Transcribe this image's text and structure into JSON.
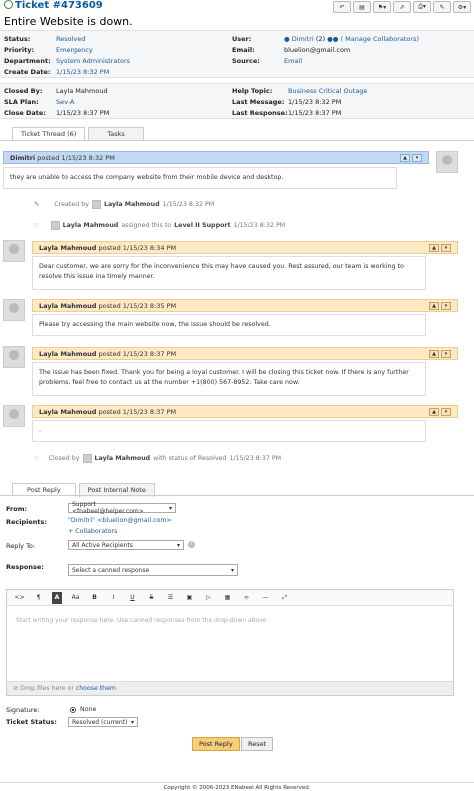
{
  "ticket": {
    "number": "Ticket #473609",
    "subject": "Entire Website is down."
  },
  "toolbar": {
    "icons": [
      "reply-icon",
      "file-icon",
      "flag-icon",
      "share-icon",
      "print-icon",
      "edit-icon",
      "gear-icon"
    ]
  },
  "info_left": [
    {
      "label": "Status:",
      "value": "Resolved"
    },
    {
      "label": "Priority:",
      "value": "Emergency"
    },
    {
      "label": "Department:",
      "value": "System Administrators"
    },
    {
      "label": "Create Date:",
      "value": "1/15/23 8:32 PM"
    }
  ],
  "info_right": {
    "user_label": "User:",
    "user_value": "Dimitri",
    "user_count": "(2)",
    "manage_link": "( Manage Collaborators)",
    "email_label": "Email:",
    "email_value": "bluelion@gmail.com",
    "source_label": "Source:",
    "source_value": "Email"
  },
  "info2_left": [
    {
      "label": "Closed By:",
      "value": "Layla Mahmoud"
    },
    {
      "label": "SLA Plan:",
      "value": "Sev-A"
    },
    {
      "label": "Close Date:",
      "value": "1/15/23 8:37 PM"
    }
  ],
  "info2_right": [
    {
      "label": "Help Topic:",
      "value": "Business Critical Outage"
    },
    {
      "label": "Last Message:",
      "value": "1/15/23 8:32 PM"
    },
    {
      "label": "Last Response:",
      "value": "1/15/23 8:37 PM"
    }
  ],
  "thread_tabs": {
    "thread": "Ticket Thread (6)",
    "tasks": "Tasks"
  },
  "messages": [
    {
      "author": "Dimitri",
      "posted": "posted",
      "time": "1/15/23 8:32 PM",
      "body": "they are unable to access the company website from their mobile device and desktop."
    },
    {
      "author": "Layla Mahmoud",
      "posted": "posted",
      "time": "1/15/23 8:34 PM",
      "body": "Dear customer, we are sorry for the inconvenience this may have caused you. Rest assured, our team is working to resolve this issue ina  timely manner."
    },
    {
      "author": "Layla Mahmoud",
      "posted": "posted",
      "time": "1/15/23 8:35 PM",
      "body": "Please try accessing the main website now, the issue should be resolved."
    },
    {
      "author": "Layla Mahmoud",
      "posted": "posted",
      "time": "1/15/23 8:37 PM",
      "body": "The issue has been fixed. Thank you for being a loyal customer. I will be closing this ticket now. If there is any further problems, feel free to contact us at the number +1(800) 567-8952. Take care now."
    },
    {
      "author": "Layla Mahmoud",
      "posted": "posted",
      "time": "1/15/23 8:37 PM",
      "body": "."
    }
  ],
  "events": {
    "created_by": "Created by",
    "created_who": "Layla Mahmoud",
    "created_time": "1/15/23 8:32 PM",
    "assigned_who": "Layla Mahmoud",
    "assigned_text": "assigned this to",
    "assigned_target": "Level II Support",
    "assigned_time": "1/15/23 8:32 PM",
    "closed_by": "Closed by",
    "closed_who": "Layla Mahmoud",
    "closed_text": "with status of Resolved",
    "closed_time": "1/15/23 8:37 PM"
  },
  "reply_tabs": {
    "post_reply": "Post Reply",
    "internal_note": "Post Internal Note"
  },
  "form": {
    "from_label": "From:",
    "from_value": "Support <fnabeel@helper.com>",
    "recipients_label": "Recipients:",
    "recipient": "\"Dimitri\" <bluelion@gmail.com>",
    "collaborators": "+ Collaborators",
    "reply_to_label": "Reply To:",
    "reply_to_value": "All Active Recipients",
    "response_label": "Response:",
    "response_placeholder": "Select a canned response",
    "editor_placeholder": "Start writing your response here. Use canned responses from the drop-down above",
    "drop_files": "Drop files here or",
    "choose_them": "choose them",
    "signature_label": "Signature:",
    "signature_value": "None",
    "ticket_status_label": "Ticket Status:",
    "ticket_status_value": "Resolved (current)",
    "post_button": "Post Reply",
    "reset_button": "Reset"
  },
  "editor_tools": [
    "code-icon",
    "paragraph-icon",
    "text-color-icon",
    "font-size-icon",
    "bold-icon",
    "italic-icon",
    "underline-icon",
    "strikethrough-icon",
    "list-icon",
    "image-icon",
    "video-icon",
    "table-icon",
    "link-icon",
    "hr-icon",
    "fullscreen-icon"
  ],
  "footer": "Copyright © 2006-2023 ENabeel All Rights Reserved."
}
